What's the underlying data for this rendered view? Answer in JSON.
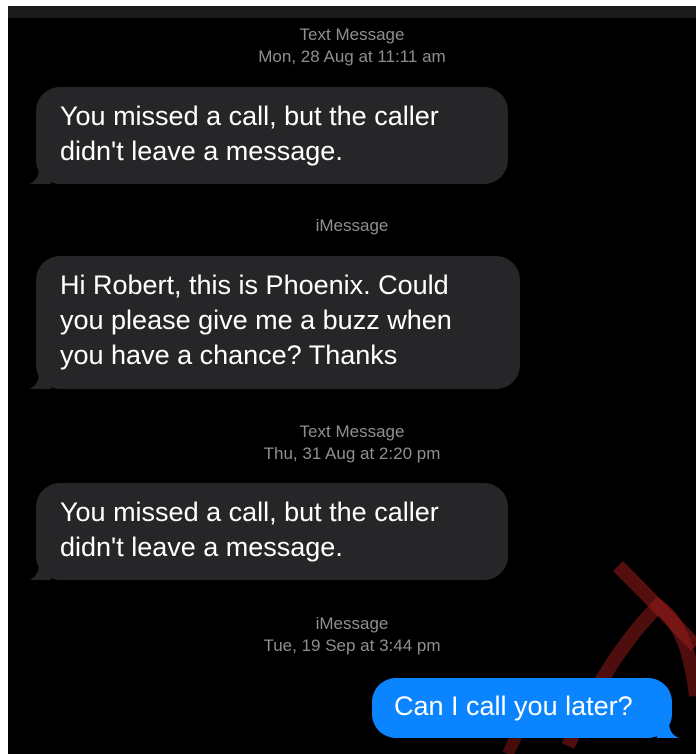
{
  "conversation": [
    {
      "meta": {
        "service": "Text Message",
        "timestamp": "Mon, 28 Aug at 11:11 am"
      },
      "message": {
        "direction": "incoming",
        "text": "You missed a call, but the caller didn't leave a message."
      }
    },
    {
      "meta": {
        "service": "iMessage",
        "timestamp": ""
      },
      "message": {
        "direction": "incoming",
        "text": "Hi Robert, this is Phoenix. Could you please give me a buzz when you have a chance? Thanks"
      }
    },
    {
      "meta": {
        "service": "Text Message",
        "timestamp": "Thu, 31 Aug at 2:20 pm"
      },
      "message": {
        "direction": "incoming",
        "text": "You missed a call, but the caller didn't leave a message."
      }
    },
    {
      "meta": {
        "service": "iMessage",
        "timestamp": "Tue, 19 Sep at 3:44 pm"
      },
      "message": {
        "direction": "outgoing",
        "text": "Can I call you later?"
      }
    }
  ],
  "colors": {
    "background": "#000000",
    "incoming_bubble": "#262628",
    "outgoing_bubble": "#0a84ff",
    "meta_text": "#8e8e93",
    "watermark": "#c0392b"
  }
}
